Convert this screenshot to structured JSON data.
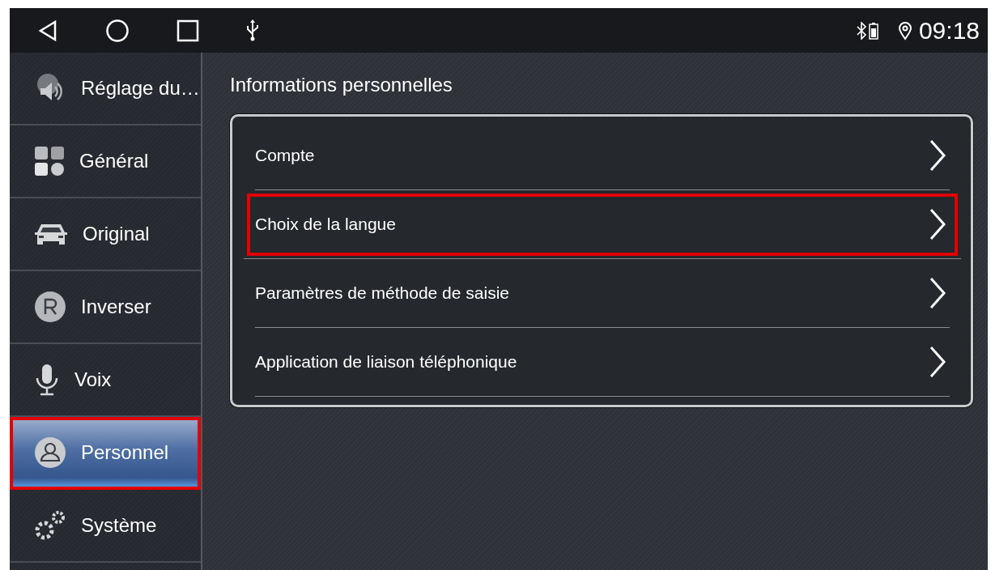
{
  "status_bar": {
    "time": "09:18"
  },
  "sidebar": {
    "items": [
      {
        "kind": "sound",
        "label": "Réglage du…",
        "selected": false,
        "highlighted": false
      },
      {
        "kind": "general",
        "label": "Général",
        "selected": false,
        "highlighted": false
      },
      {
        "kind": "car",
        "label": "Original",
        "selected": false,
        "highlighted": false
      },
      {
        "kind": "reverse",
        "label": "Inverser",
        "selected": false,
        "highlighted": false
      },
      {
        "kind": "voice",
        "label": "Voix",
        "selected": false,
        "highlighted": false
      },
      {
        "kind": "person",
        "label": "Personnel",
        "selected": true,
        "highlighted": true
      },
      {
        "kind": "system",
        "label": "Système",
        "selected": false,
        "highlighted": false
      }
    ]
  },
  "main": {
    "title": "Informations personnelles",
    "items": [
      {
        "label": "Compte",
        "highlighted": false
      },
      {
        "label": "Choix de la langue",
        "highlighted": true
      },
      {
        "label": "Paramètres de méthode de saisie",
        "highlighted": false
      },
      {
        "label": "Application de liaison téléphonique",
        "highlighted": false
      }
    ]
  }
}
